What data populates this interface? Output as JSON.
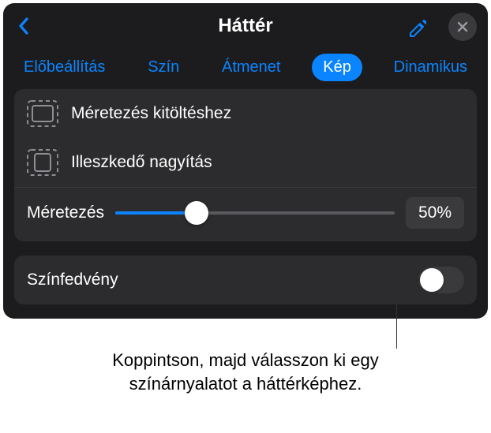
{
  "header": {
    "title": "Háttér"
  },
  "tabs": {
    "preset": "Előbeállítás",
    "color": "Szín",
    "gradient": "Átmenet",
    "image": "Kép",
    "dynamic": "Dinamikus",
    "active": "image"
  },
  "options": {
    "scale_to_fill": "Méretezés kitöltéshez",
    "scale_to_fit": "Illeszkedő nagyítás"
  },
  "slider": {
    "label": "Méretezés",
    "value": 50,
    "display": "50%"
  },
  "overlay": {
    "label": "Színfedvény",
    "on": false
  },
  "callout": {
    "text_line1": "Koppintson, majd válasszon ki egy",
    "text_line2": "színárnyalatot a háttérképhez."
  },
  "colors": {
    "accent": "#0a84ff",
    "panel_bg": "#1c1c1e",
    "card_bg": "#2c2c2e"
  }
}
